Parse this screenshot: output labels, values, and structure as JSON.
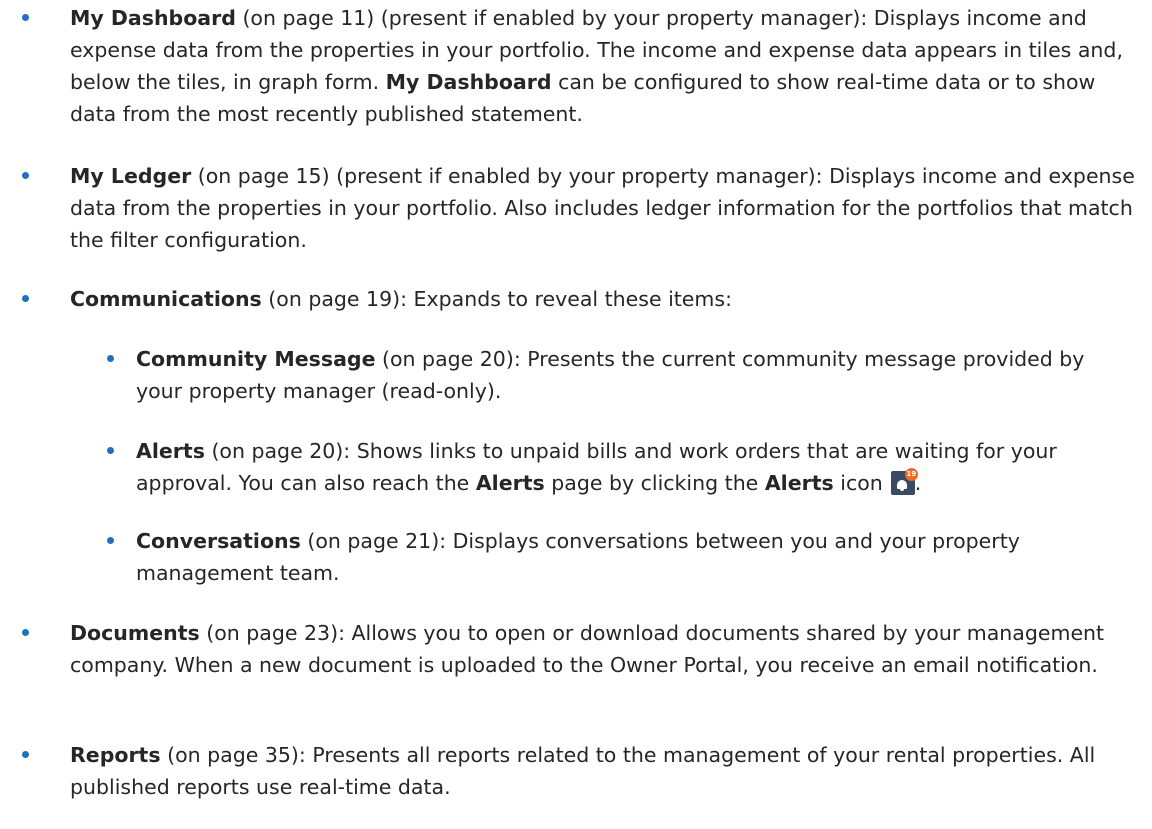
{
  "items": [
    {
      "term": "My Dashboard",
      "text": " (on page 11) (present if enabled by your property manager): Displays income and expense data from the properties in your portfolio. The income and expense data appears in tiles and, below the tiles, in graph form. ",
      "term2": "My Dashboard",
      "text2": " can be configured to show real-time data or to show data from the most recently published statement."
    },
    {
      "term": "My Ledger",
      "text": " (on page 15) (present if enabled by your property manager): Displays income and expense data from the properties in your portfolio. Also includes ledger information for the portfolios that match the filter configuration."
    },
    {
      "term": "Communications",
      "text": " (on page 19): Expands to reveal these items:"
    },
    {
      "term": "Community Message",
      "text": " (on page 20): Presents the current community message provided by your property manager (read-only)."
    },
    {
      "term": "Alerts",
      "text": " (on page 20): Shows links to unpaid bills and work orders that are waiting for your approval. You can also reach the ",
      "term2": "Alerts",
      "text2": " page by clicking the ",
      "term3": "Alerts",
      "text3": " icon",
      "text4": ".",
      "badge": "19"
    },
    {
      "term": "Conversations",
      "text": " (on page 21): Displays conversations between you and your property management team."
    },
    {
      "term": "Documents",
      "text": " (on page 23): Allows you to open or download documents shared by your management company. When a new document is uploaded to the Owner Portal, you receive an email notification."
    },
    {
      "term": "Reports",
      "text": " (on page 35): Presents all reports related to the management of your rental properties. All published reports use real-time data."
    }
  ],
  "colors": {
    "bullet": "#1f70c1",
    "text": "#262626",
    "badge": "#f26a21"
  },
  "icons": [
    "alerts-bell-icon"
  ]
}
